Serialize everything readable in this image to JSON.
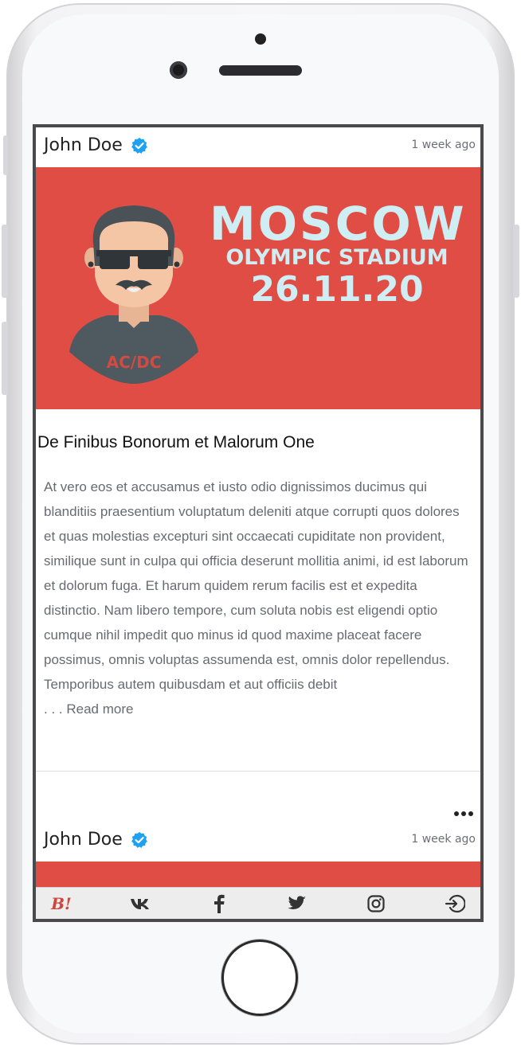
{
  "posts": [
    {
      "author": "John Doe",
      "timestamp": "1 week ago",
      "banner": {
        "line1": "MOSCOW",
        "line2": "OLYMPIC STADIUM",
        "line3": "26.11.20",
        "shirt_text": "AC/DC"
      },
      "title": "De Finibus Bonorum et Malorum One",
      "body": "At vero eos et accusamus et iusto odio dignissimos ducimus qui blanditiis praesentium voluptatum deleniti atque corrupti quos dolores et quas molestias excepturi sint occaecati cupiditate non provident, similique sunt in culpa qui officia deserunt mollitia animi, id est laborum et dolorum fuga. Et harum quidem rerum facilis est et expedita distinctio. Nam libero tempore, cum soluta nobis est eligendi optio cumque nihil impedit quo minus id quod maxime placeat facere possimus, omnis voluptas assumenda est, omnis dolor repellendus. Temporibus autem quibusdam et aut officiis debit",
      "read_more": ". . . Read more"
    },
    {
      "author": "John Doe",
      "timestamp": "1 week ago"
    }
  ],
  "nav": {
    "brand": "B!",
    "items": [
      "brand-icon",
      "vk-icon",
      "facebook-icon",
      "twitter-icon",
      "instagram-icon",
      "login-icon"
    ]
  },
  "colors": {
    "accent": "#e04d45",
    "banner_text": "#cfeef3",
    "verified": "#1da1f2"
  }
}
